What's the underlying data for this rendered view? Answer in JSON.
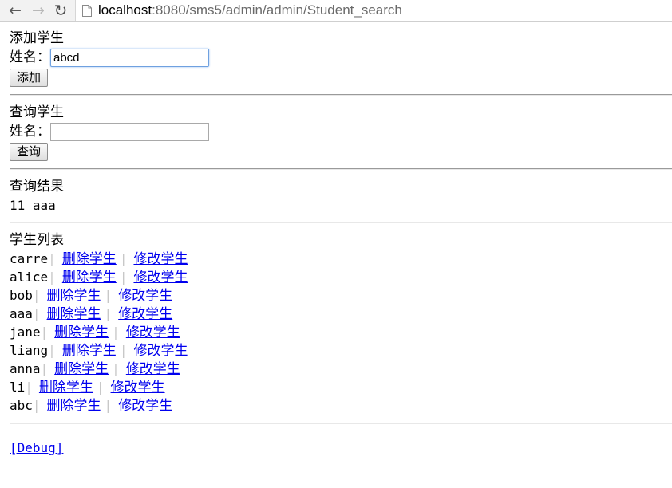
{
  "browser": {
    "url_host": "localhost",
    "url_rest": ":8080/sms5/admin/admin/Student_search"
  },
  "add_section": {
    "title": "添加学生",
    "name_label": "姓名：",
    "name_value": "abcd",
    "button_label": "添加"
  },
  "search_section": {
    "title": "查询学生",
    "name_label": "姓名：",
    "name_value": "",
    "button_label": "查询"
  },
  "result_section": {
    "title": "查询结果",
    "result_text": "11 aaa"
  },
  "list_section": {
    "title": "学生列表",
    "delete_label": "删除学生",
    "edit_label": "修改学生",
    "students": [
      "carre",
      "alice",
      "bob",
      "aaa",
      "jane",
      "liang",
      "anna",
      "li",
      "abc"
    ]
  },
  "debug_link": "[Debug]"
}
